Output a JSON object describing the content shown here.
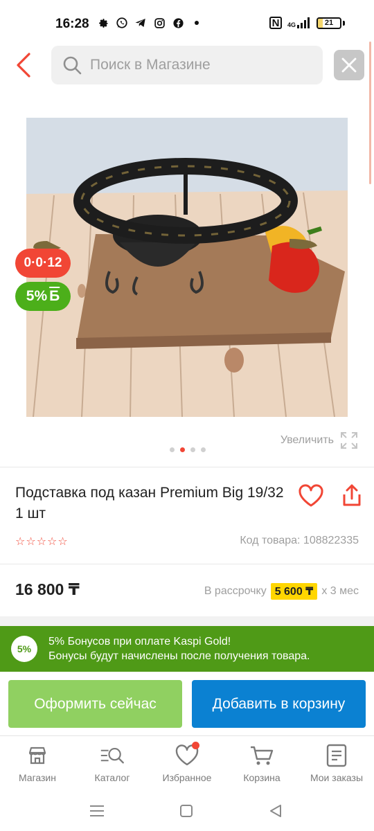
{
  "status_bar": {
    "time": "16:28",
    "battery": "21",
    "battery_level": 0.21,
    "network_label": "4G",
    "icons": [
      "settings-icon",
      "whatsapp-icon",
      "telegram-icon",
      "instagram-icon",
      "facebook-icon",
      "nfc-icon",
      "signal-icon",
      "battery-icon"
    ]
  },
  "header": {
    "search_placeholder": "Поиск в Магазине"
  },
  "product": {
    "installment_badge": "0·0·12",
    "bonus_badge": "5%",
    "bonus_badge_suffix": "Б",
    "zoom_label": "Увеличить",
    "image_count": 4,
    "active_image_index": 1,
    "title": "Подставка под казан Premium Big 19/32 1 шт",
    "sku": "Код товара: 108822335",
    "rating_stars": 0,
    "price": "16 800 ₸",
    "installment_prefix": "В рассрочку",
    "installment_amount": "5 600 ₸",
    "installment_suffix": "x 3 мес"
  },
  "bonus_banner": {
    "badge": "5%",
    "line1": "5% Бонусов при оплате Kaspi Gold!",
    "line2": "Бонусы будут начислены после получения товара."
  },
  "actions": {
    "buy_now": "Оформить сейчас",
    "add_to_cart": "Добавить в корзину"
  },
  "tabs": [
    {
      "label": "Магазин",
      "icon": "shop-icon"
    },
    {
      "label": "Каталог",
      "icon": "catalog-icon"
    },
    {
      "label": "Избранное",
      "icon": "heart-icon"
    },
    {
      "label": "Корзина",
      "icon": "cart-icon"
    },
    {
      "label": "Мои заказы",
      "icon": "orders-icon"
    }
  ],
  "colors": {
    "accent_red": "#f14635",
    "bonus_green": "#4f9a17",
    "buy_now_green": "#90d061",
    "cart_blue": "#0b81d2",
    "installment_yellow": "#ffd600"
  }
}
